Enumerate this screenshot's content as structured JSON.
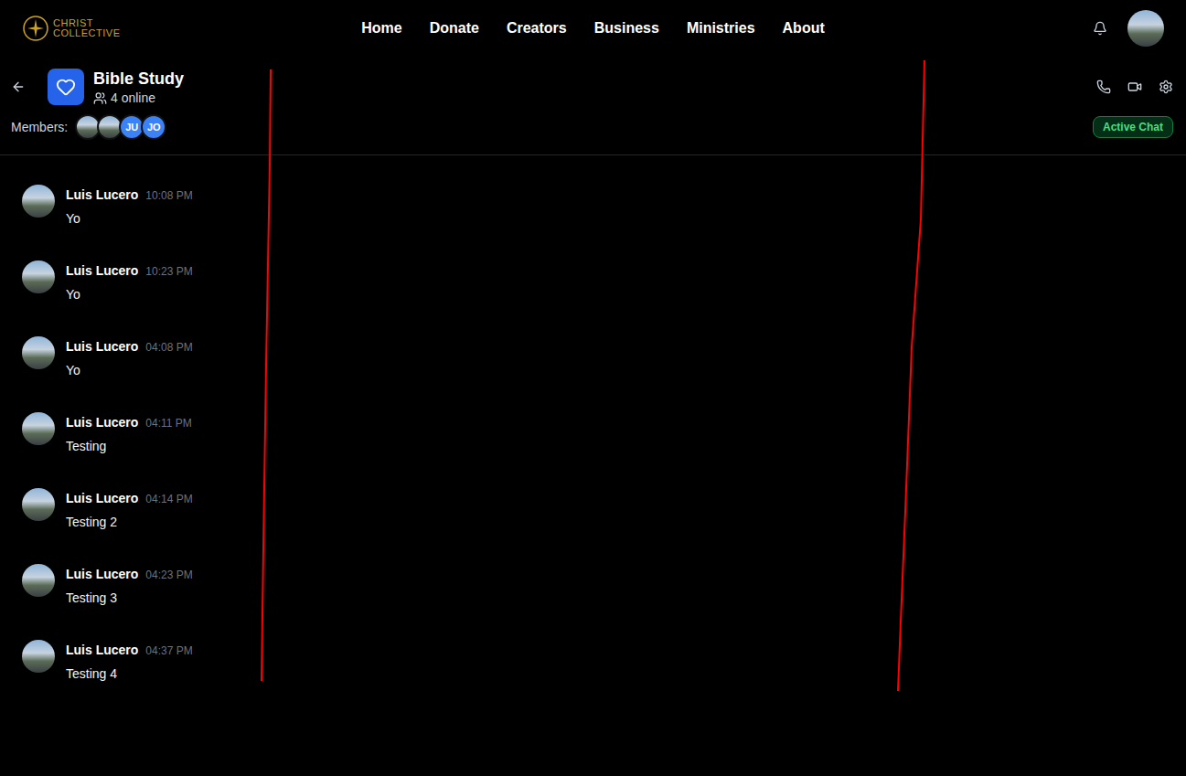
{
  "nav": {
    "logo": {
      "line1": "CHRIST",
      "line2": "COLLECTIVE"
    },
    "links": [
      {
        "label": "Home"
      },
      {
        "label": "Donate"
      },
      {
        "label": "Creators"
      },
      {
        "label": "Business"
      },
      {
        "label": "Ministries"
      },
      {
        "label": "About"
      }
    ]
  },
  "chat": {
    "title": "Bible Study",
    "online": "4 online",
    "members_label": "Members:",
    "members": [
      {
        "kind": "photo"
      },
      {
        "kind": "photo"
      },
      {
        "kind": "initials",
        "initials": "JU"
      },
      {
        "kind": "initials",
        "initials": "JO"
      }
    ],
    "status": "Active Chat"
  },
  "messages": [
    {
      "author": "Luis Lucero",
      "time": "10:08 PM",
      "text": "Yo"
    },
    {
      "author": "Luis Lucero",
      "time": "10:23 PM",
      "text": "Yo"
    },
    {
      "author": "Luis Lucero",
      "time": "04:08 PM",
      "text": "Yo"
    },
    {
      "author": "Luis Lucero",
      "time": "04:11 PM",
      "text": "Testing"
    },
    {
      "author": "Luis Lucero",
      "time": "04:14 PM",
      "text": "Testing 2"
    },
    {
      "author": "Luis Lucero",
      "time": "04:23 PM",
      "text": "Testing 3"
    },
    {
      "author": "Luis Lucero",
      "time": "04:37 PM",
      "text": "Testing 4"
    }
  ]
}
